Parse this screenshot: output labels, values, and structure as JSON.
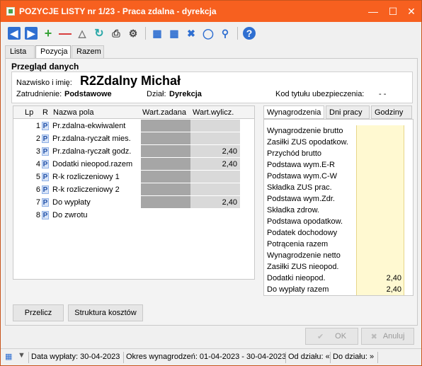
{
  "window": {
    "title": "POZYCJE LISTY nr 1/23 - Praca zdalna - dyrekcja"
  },
  "tabs": [
    "Lista",
    "Pozycja",
    "Razem"
  ],
  "section": {
    "title": "Przegląd danych"
  },
  "employee": {
    "name_label": "Nazwisko i imię:",
    "name_value": "R2Zdalny Michał",
    "employment_label": "Zatrudnienie:",
    "employment_value": "Podstawowe",
    "dept_label": "Dział:",
    "dept_value": "Dyrekcja",
    "insurance_label": "Kod tytułu ubezpieczenia:",
    "insurance_value": "- -"
  },
  "grid": {
    "headers": [
      "Lp",
      "R",
      "Nazwa pola",
      "Wart.zadana",
      "Wart.wylicz."
    ],
    "rows": [
      {
        "lp": "1",
        "r": "P",
        "name": "Pr.zdalna-ekwiwalent",
        "wz": "",
        "ww": ""
      },
      {
        "lp": "2",
        "r": "P",
        "name": "Pr.zdalna-ryczałt mies.",
        "wz": "",
        "ww": ""
      },
      {
        "lp": "3",
        "r": "P",
        "name": "Pr.zdalna-ryczałt godz.",
        "wz": "",
        "ww": "2,40"
      },
      {
        "lp": "4",
        "r": "P",
        "name": "Dodatki nieopod.razem",
        "wz": "",
        "ww": "2,40"
      },
      {
        "lp": "5",
        "r": "P",
        "name": "R-k rozliczeniowy 1",
        "wz": "",
        "ww": ""
      },
      {
        "lp": "6",
        "r": "P",
        "name": "R-k rozliczeniowy 2",
        "wz": "",
        "ww": ""
      },
      {
        "lp": "7",
        "r": "P",
        "name": "Do wypłaty",
        "wz": "",
        "ww": "2,40"
      },
      {
        "lp": "8",
        "r": "P",
        "name": "Do zwrotu",
        "wz": "",
        "ww": ""
      }
    ]
  },
  "right_tabs": [
    "Wynagrodzenia",
    "Dni pracy",
    "Godziny"
  ],
  "summary": [
    {
      "label": "Wynagrodzenie brutto",
      "value": ""
    },
    {
      "label": "Zasiłki ZUS opodatkow.",
      "value": ""
    },
    {
      "label": "Przychód brutto",
      "value": ""
    },
    {
      "label": "Podstawa wym.E-R",
      "value": ""
    },
    {
      "label": "Podstawa wym.C-W",
      "value": ""
    },
    {
      "label": "Składka ZUS prac.",
      "value": ""
    },
    {
      "label": "Podstawa wym.Zdr.",
      "value": ""
    },
    {
      "label": "Składka zdrow.",
      "value": ""
    },
    {
      "label": "Podstawa opodatkow.",
      "value": ""
    },
    {
      "label": "Podatek dochodowy",
      "value": ""
    },
    {
      "label": "Potrącenia razem",
      "value": ""
    },
    {
      "label": "Wynagrodzenie netto",
      "value": ""
    },
    {
      "label": "Zasiłki ZUS nieopod.",
      "value": ""
    },
    {
      "label": "Dodatki nieopod.",
      "value": "2,40"
    },
    {
      "label": "Do wypłaty razem",
      "value": "2,40"
    }
  ],
  "buttons": {
    "przelicz": "Przelicz",
    "struktura": "Struktura kosztów",
    "ok": "OK",
    "anuluj": "Anuluj"
  },
  "status": {
    "data_wyplaty": "Data wypłaty: 30-04-2023",
    "okres": "Okres wynagrodzeń: 01-04-2023 - 30-04-2023",
    "od_dzialu": "Od działu: «",
    "do_dzialu": "Do działu: »"
  }
}
